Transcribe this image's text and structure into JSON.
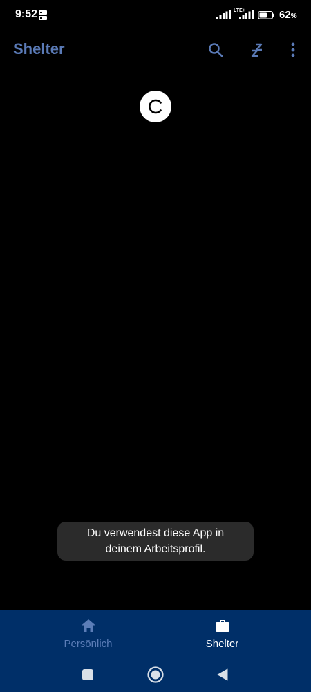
{
  "status_bar": {
    "time": "9:52",
    "network": "LTE+",
    "battery_percent": 62,
    "battery_label": "62",
    "battery_unit": "%"
  },
  "app_bar": {
    "title": "Shelter",
    "title_color": "#5a7ab6",
    "actions": [
      "search-icon",
      "snooze-icon",
      "more-vert-icon"
    ]
  },
  "loading": {
    "icon": "loading-spinner-icon"
  },
  "toast": {
    "line1": "Du verwendest diese App in",
    "line2": "deinem Arbeitsprofil."
  },
  "bottom_nav": {
    "background": "#002f68",
    "items": [
      {
        "label": "Persönlich",
        "icon": "home-icon",
        "active": false
      },
      {
        "label": "Shelter",
        "icon": "briefcase-icon",
        "active": true
      }
    ]
  },
  "system_nav": {
    "buttons": [
      "recents-square-icon",
      "home-circle-icon",
      "back-triangle-icon"
    ]
  }
}
